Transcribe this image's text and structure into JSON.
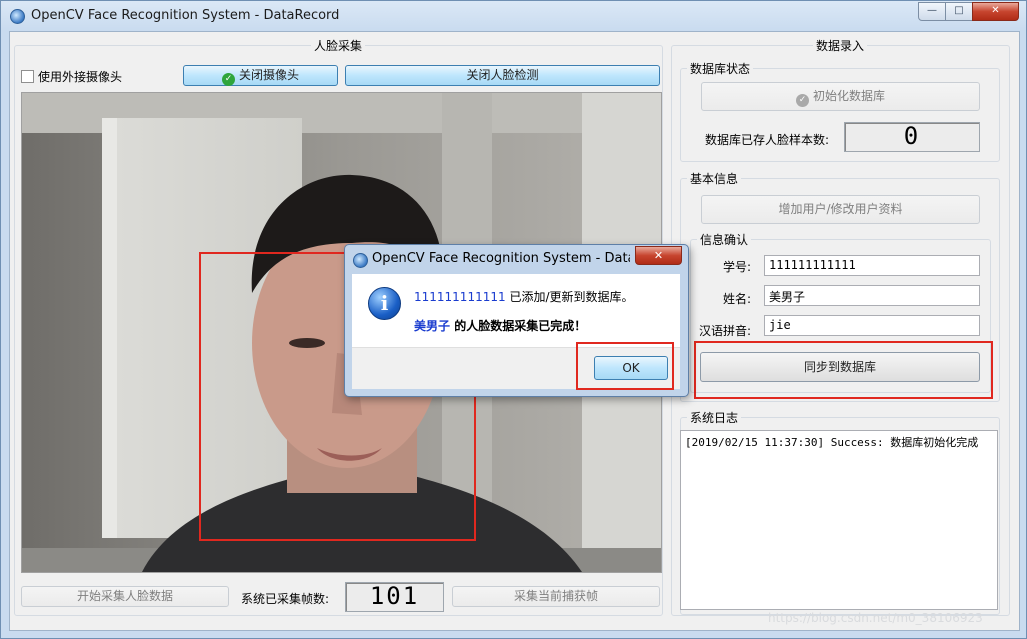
{
  "window": {
    "title": "OpenCV Face Recognition System - DataRecord",
    "min": "—",
    "max": "□",
    "close": "✕"
  },
  "capture": {
    "title": "人脸采集",
    "external_camera_label": "使用外接摄像头",
    "close_camera_button": "关闭摄像头",
    "close_face_detect_button": "关闭人脸检测",
    "start_collect_button": "开始采集人脸数据",
    "frames_label": "系统已采集帧数:",
    "frames_value": "101",
    "capture_frame_button": "采集当前捕获帧"
  },
  "record": {
    "title": "数据录入",
    "db_status_title": "数据库状态",
    "init_db_button": "初始化数据库",
    "samples_label": "数据库已存人脸样本数:",
    "samples_value": "0",
    "basic_info_title": "基本信息",
    "add_user_button": "增加用户/修改用户资料",
    "confirm_title": "信息确认",
    "student_id_label": "学号:",
    "student_id_value": "111111111111",
    "name_label": "姓名:",
    "name_value": "美男子",
    "pinyin_label": "汉语拼音:",
    "pinyin_value": "jie",
    "sync_button": "同步到数据库"
  },
  "log": {
    "title": "系统日志",
    "lines": [
      "[2019/02/15 11:37:30] Success: 数据库初始化完成"
    ]
  },
  "dialog": {
    "title": "OpenCV Face Recognition System - DataRe...",
    "close": "✕",
    "line1_id": "111111111111",
    "line1_text": " 已添加/更新到数据库。",
    "line2_name": "美男子",
    "line2_text": " 的人脸数据采集已完成！",
    "ok_button": "OK"
  },
  "watermark": "https://blog.csdn.net/m0_38106923",
  "colors": {
    "highlight_red": "#e0281f",
    "accent_blue": "#1a3ccf"
  }
}
